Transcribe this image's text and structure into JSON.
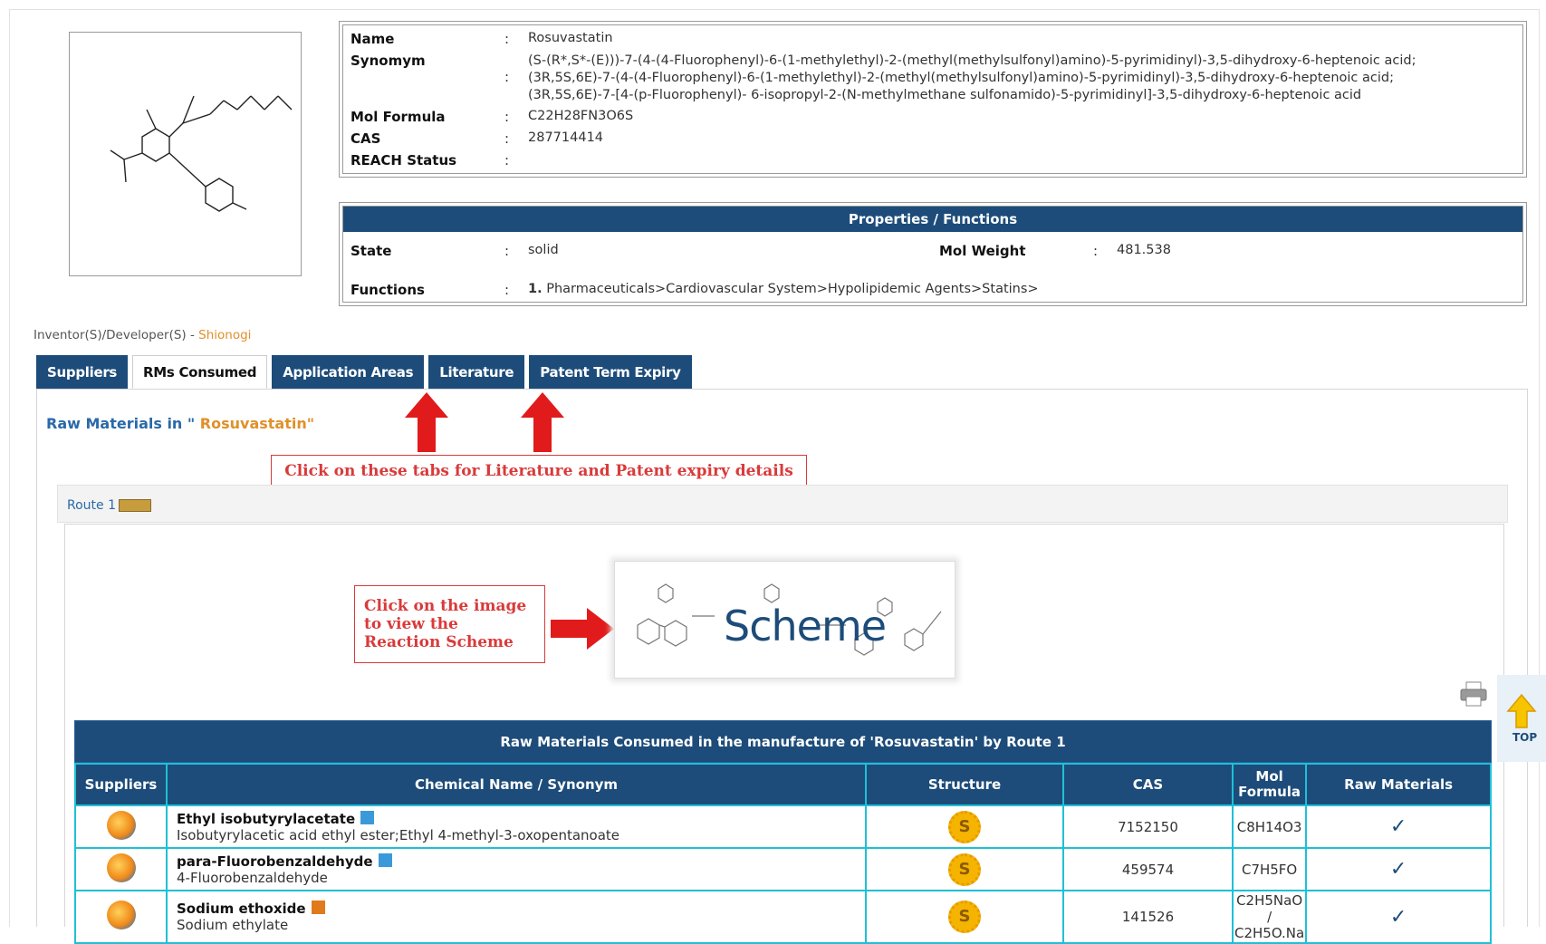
{
  "compound": {
    "labels": {
      "name": "Name",
      "synonym": "Synomym",
      "formula": "Mol Formula",
      "cas": "CAS",
      "reach": "REACH Status"
    },
    "name": "Rosuvastatin",
    "synonyms": [
      "(S-(R*,S*-(E)))-7-(4-(4-Fluorophenyl)-6-(1-methylethyl)-2-(methyl(methylsulfonyl)amino)-5-pyrimidinyl)-3,5-dihydroxy-6-heptenoic acid;",
      "(3R,5S,6E)-7-(4-(4-Fluorophenyl)-6-(1-methylethyl)-2-(methyl(methylsulfonyl)amino)-5-pyrimidinyl)-3,5-dihydroxy-6-heptenoic acid;",
      "(3R,5S,6E)-7-[4-(p-Fluorophenyl)- 6-isopropyl-2-(N-methylmethane sulfonamido)-5-pyrimidinyl]-3,5-dihydroxy-6-heptenoic acid"
    ],
    "formula": "C22H28FN3O6S",
    "cas": "287714414",
    "reach_status": ""
  },
  "properties": {
    "heading": "Properties / Functions",
    "state_label": "State",
    "state": "solid",
    "mol_weight_label": "Mol Weight",
    "mol_weight": "481.538",
    "functions_label": "Functions",
    "function_index": "1.",
    "function_path": "Pharmaceuticals>Cardiovascular System>Hypolipidemic Agents>Statins>"
  },
  "inventor": {
    "label": "Inventor(S)/Developer(S) - ",
    "value": "Shionogi"
  },
  "tabs": [
    "Suppliers",
    "RMs Consumed",
    "Application Areas",
    "Literature",
    "Patent Term Expiry"
  ],
  "active_tab": "RMs Consumed",
  "raw_title": {
    "prefix": "Raw Materials in \"",
    "name": " Rosuvastatin\""
  },
  "annotations": {
    "tabs_note": "Click on these tabs for Literature and Patent expiry details",
    "image_note": "Click on the image to view the Reaction Scheme"
  },
  "route": {
    "label": "Route 1"
  },
  "scheme": {
    "label": "Scheme"
  },
  "top_button": "TOP",
  "table": {
    "caption": "Raw Materials Consumed in the manufacture of 'Rosuvastatin' by Route 1",
    "headers": [
      "Suppliers",
      "Chemical Name / Synonym",
      "Structure",
      "CAS",
      "Mol Formula",
      "Raw Materials"
    ],
    "rows": [
      {
        "name": "Ethyl isobutyrylacetate",
        "synonym": "Isobutyrylacetic acid ethyl ester;Ethyl 4-methyl-3-oxopentanoate",
        "cas": "7152150",
        "formula": "C8H14O3",
        "flag_color": "#3a9ad9"
      },
      {
        "name": "para-Fluorobenzaldehyde",
        "synonym": "4-Fluorobenzaldehyde",
        "cas": "459574",
        "formula": "C7H5FO",
        "flag_color": "#3a9ad9"
      },
      {
        "name": "Sodium ethoxide",
        "synonym": "Sodium ethylate",
        "cas": "141526",
        "formula": "C2H5NaO / C2H5O.Na",
        "flag_color": "#e07a1a"
      }
    ]
  },
  "colors": {
    "header_blue": "#1d4c7a",
    "grid_cyan": "#1ec0d6",
    "accent_orange": "#e0902a",
    "annotation_red": "#d93a3a"
  }
}
